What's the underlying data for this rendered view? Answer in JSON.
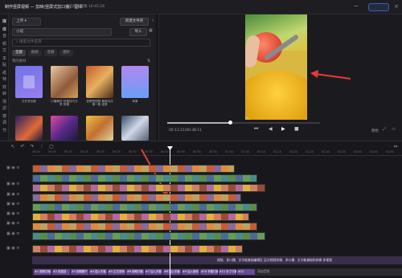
{
  "titlebar": {
    "title": "制作竖屏视频 — 剪映(竖屏式剪口播) · 副本",
    "saved": "已保存草稿 16:45:26",
    "account": ""
  },
  "leftbar": {
    "items": [
      "媒体",
      "音频",
      "文本",
      "贴纸",
      "特效",
      "转场",
      "滤镜",
      "调节"
    ]
  },
  "media": {
    "top_left_dropdown": "上传",
    "top_right_button": "新建文件夹",
    "second_dropdown": "小说",
    "import_button": "导入",
    "search_placeholder": "搜索文件名称",
    "filters": [
      "全部",
      "视频",
      "音频",
      "图片"
    ],
    "section_label": "我的素材",
    "clips": [
      {
        "caption": "文件夹功能"
      },
      {
        "caption": "口播素材 拍摄技巧分享 剪辑"
      },
      {
        "caption": "竖屏短视频 最新玩法 第一集 竖屏"
      },
      {
        "caption": "背景"
      },
      {
        "caption": ""
      },
      {
        "caption": ""
      },
      {
        "caption": ""
      },
      {
        "caption": ""
      }
    ]
  },
  "player": {
    "time": "00:11:21/00:38:11",
    "ratio": "原始",
    "arrow_label": ""
  },
  "timeline": {
    "ruler_ticks": [
      "00:00",
      "00:05",
      "00:10",
      "00:15",
      "00:20",
      "00:25",
      "00:30",
      "00:35",
      "00:40",
      "00:45",
      "00:50",
      "00:55",
      "01:00",
      "01:05",
      "01:10",
      "01:15",
      "01:20",
      "01:25",
      "01:30",
      "01:35",
      "01:40",
      "01:45",
      "01:50"
    ],
    "subtitle_text": "视频、多口播、文字能基础编辑区 层次视频剪辑、多口播、文字能基础和剪辑 多视频",
    "labels": [
      "#1 视频口播",
      "#2 前描述",
      "#3 视频题干",
      "#4 插入字幕",
      "#5 正文说明",
      "#6 视频口播",
      "#7 加入字幕",
      "#8 加入字幕",
      "#9 加入音效",
      "#10 节奏口播",
      "#11 补丁口播",
      "#12"
    ],
    "label_tail": "添加音频"
  },
  "colors": {
    "accent": "#3a68e0",
    "red_arrow": "#e53b3b",
    "playhead": "#ffffff"
  }
}
